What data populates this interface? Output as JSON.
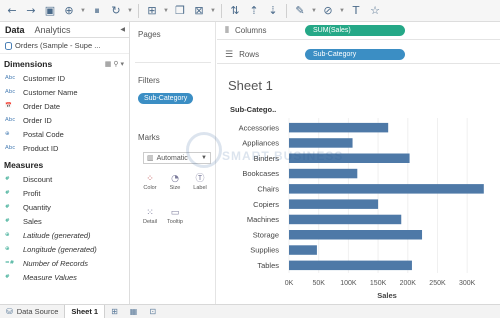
{
  "toolbar": {
    "icons": [
      "back-arrow",
      "forward-arrow",
      "save",
      "new-data-source",
      "pause-updates",
      "refresh",
      "new-worksheet",
      "duplicate-sheet",
      "clear-sheet",
      "swap-axes",
      "sort-ascending",
      "sort-descending",
      "group",
      "highlight",
      "tooltip-text",
      "fix-axes"
    ]
  },
  "data_pane": {
    "tabs": [
      "Data",
      "Analytics"
    ],
    "datasource": "Orders (Sample - Supe ...",
    "dimensions_header": "Dimensions",
    "dimensions": [
      {
        "type": "Abc",
        "label": "Customer ID"
      },
      {
        "type": "Abc",
        "label": "Customer Name"
      },
      {
        "type": "📅",
        "label": "Order Date"
      },
      {
        "type": "Abc",
        "label": "Order ID"
      },
      {
        "type": "⊕",
        "label": "Postal Code"
      },
      {
        "type": "Abc",
        "label": "Product ID"
      }
    ],
    "measures_header": "Measures",
    "measures": [
      {
        "type": "#",
        "label": "Discount"
      },
      {
        "type": "#",
        "label": "Profit"
      },
      {
        "type": "#",
        "label": "Quantity"
      },
      {
        "type": "#",
        "label": "Sales"
      },
      {
        "type": "⊕",
        "label": "Latitude (generated)"
      },
      {
        "type": "⊕",
        "label": "Longitude (generated)"
      },
      {
        "type": "=#",
        "label": "Number of Records"
      },
      {
        "type": "#",
        "label": "Measure Values"
      }
    ]
  },
  "cards": {
    "pages": "Pages",
    "filters": "Filters",
    "filter_pill": "Sub-Category",
    "marks": "Marks",
    "mark_type": "Automatic",
    "mark_buttons": [
      "Color",
      "Size",
      "Label",
      "Detail",
      "Tooltip"
    ]
  },
  "shelves": {
    "columns_label": "Columns",
    "columns_pill": "SUM(Sales)",
    "rows_label": "Rows",
    "rows_pill": "Sub-Category"
  },
  "sheet": {
    "title": "Sheet 1"
  },
  "watermark": "SMART BUSINESS",
  "chart_data": {
    "type": "bar",
    "orientation": "horizontal",
    "row_header": "Sub-Catego..",
    "categories": [
      "Accessories",
      "Appliances",
      "Binders",
      "Bookcases",
      "Chairs",
      "Copiers",
      "Machines",
      "Storage",
      "Supplies",
      "Tables"
    ],
    "values": [
      167000,
      107000,
      203000,
      115000,
      328000,
      150000,
      189000,
      224000,
      47000,
      207000
    ],
    "xticks": [
      "0K",
      "50K",
      "100K",
      "150K",
      "200K",
      "250K",
      "300K"
    ],
    "xlabel": "Sales",
    "xlim": [
      0,
      330000
    ],
    "color": "#4e79a7"
  },
  "bottom_bar": {
    "data_source": "Data Source",
    "sheet_tab": "Sheet 1"
  }
}
